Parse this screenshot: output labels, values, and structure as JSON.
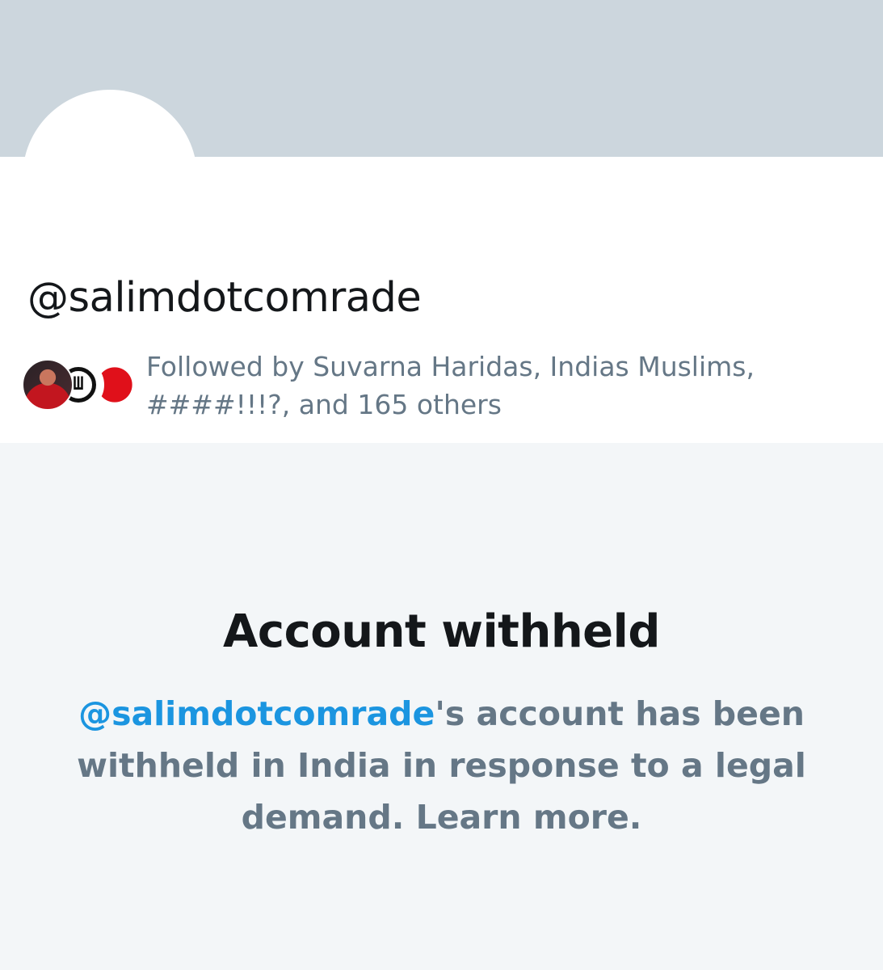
{
  "profile": {
    "handle": "@salimdotcomrade",
    "followed_by": {
      "text": "Followed by Suvarna Haridas, Indias Muslims, ####!!!?, and 165 others",
      "avatars": [
        "follower-avatar-photo",
        "follower-avatar-glyph",
        "follower-avatar-red-circle"
      ],
      "glyph": "Ш"
    }
  },
  "withheld": {
    "title": "Account withheld",
    "mention": "@salimdotcomrade",
    "message": "'s account has been withheld in India in response to a legal demand.",
    "learn_more": "Learn more."
  },
  "colors": {
    "banner": "#ccd6dd",
    "link": "#1b95e0",
    "secondary_text": "#657786",
    "primary_text": "#14171a",
    "background": "#f3f6f8"
  }
}
